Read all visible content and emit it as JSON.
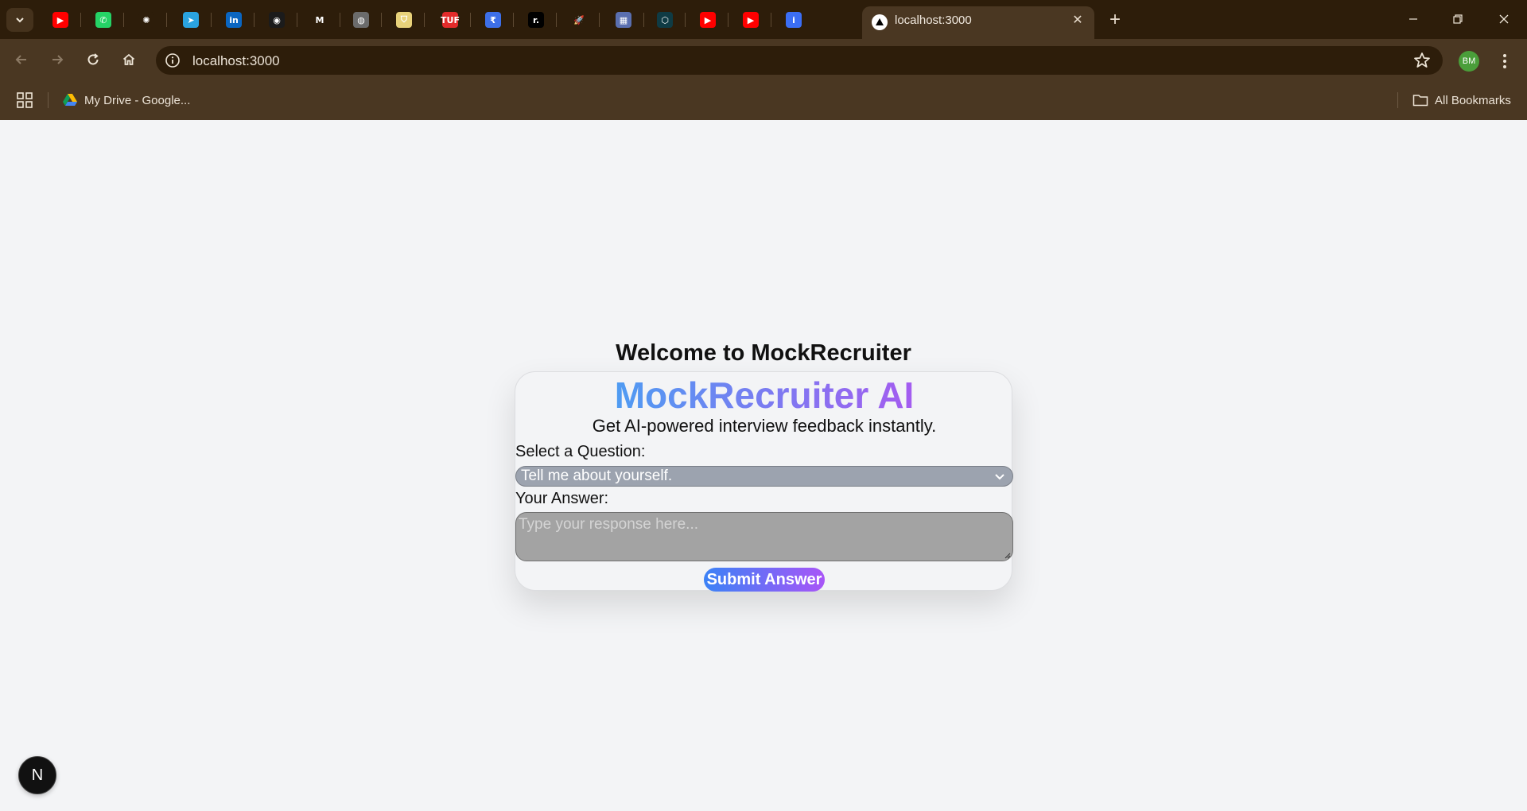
{
  "browser": {
    "pinned_tabs": [
      {
        "icon": "youtube-icon",
        "color": "#ff0000",
        "glyph": "▶"
      },
      {
        "icon": "whatsapp-icon",
        "color": "#25d366",
        "glyph": "✆"
      },
      {
        "icon": "openai-icon",
        "color": "#2d1d0a",
        "glyph": "✺"
      },
      {
        "icon": "telegram-icon",
        "color": "#2aa3e0",
        "glyph": "➤"
      },
      {
        "icon": "linkedin-icon",
        "color": "#0a66c2",
        "glyph": "in"
      },
      {
        "icon": "github-icon",
        "color": "#1b1b1b",
        "glyph": "◉"
      },
      {
        "icon": "gmail-icon",
        "color": "#2d1d0a",
        "glyph": "M"
      },
      {
        "icon": "globe-icon",
        "color": "#6b6b6b",
        "glyph": "◍"
      },
      {
        "icon": "shield-app-icon",
        "color": "#e8d27a",
        "glyph": "⛉"
      },
      {
        "icon": "tuf-icon",
        "color": "#e22b2b",
        "glyph": "TUF"
      },
      {
        "icon": "rupee-app-icon",
        "color": "#3d6fe8",
        "glyph": "₹"
      },
      {
        "icon": "r-app-icon",
        "color": "#000000",
        "glyph": "r."
      },
      {
        "icon": "rocket-icon",
        "color": "#2d1d0a",
        "glyph": "🚀"
      },
      {
        "icon": "image-app-icon",
        "color": "#5a6fb0",
        "glyph": "▦"
      },
      {
        "icon": "hexagon-app-icon",
        "color": "#0f3b44",
        "glyph": "⬡"
      },
      {
        "icon": "youtube-icon",
        "color": "#ff0000",
        "glyph": "▶"
      },
      {
        "icon": "youtube-icon",
        "color": "#ff0000",
        "glyph": "▶"
      },
      {
        "icon": "info-app-icon",
        "color": "#3b6ef5",
        "glyph": "i"
      }
    ],
    "active_tab_title": "localhost:3000",
    "url": "localhost:3000",
    "profile_initials": "BM",
    "bookmarks": {
      "drive_label": "My Drive - Google...",
      "all_label": "All Bookmarks"
    }
  },
  "page": {
    "welcome": "Welcome to MockRecruiter",
    "brand": "MockRecruiter AI",
    "tagline": "Get AI-powered interview feedback instantly.",
    "question_label": "Select a Question:",
    "question_selected": "Tell me about yourself.",
    "answer_label": "Your Answer:",
    "answer_placeholder": "Type your response here...",
    "submit_label": "Submit Answer",
    "next_badge": "N"
  }
}
